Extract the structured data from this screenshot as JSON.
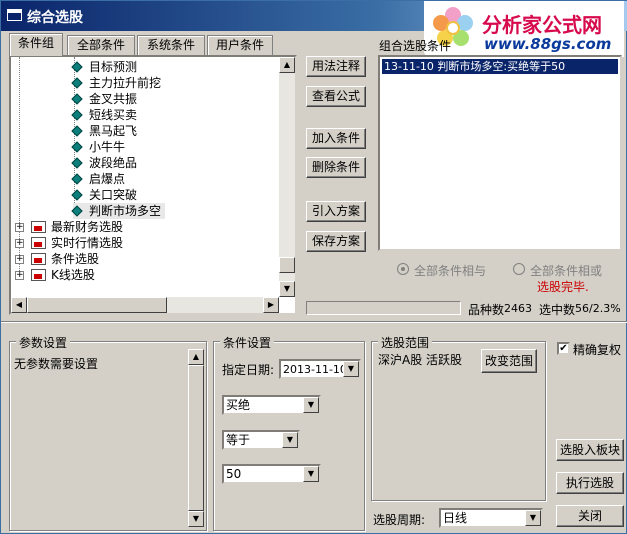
{
  "window": {
    "title": "综合选股"
  },
  "logo": {
    "main": "分析家公式网",
    "url": "www.88gs.com"
  },
  "tabs": [
    "条件组",
    "全部条件",
    "系统条件",
    "用户条件"
  ],
  "tree": {
    "leaves": [
      "目标预测",
      "主力拉升前挖",
      "金叉共振",
      "短线买卖",
      "黑马起飞",
      "小牛牛",
      "波段绝品",
      "启爆点",
      "关口突破",
      "判断市场多空"
    ],
    "groups": [
      "最新财务选股",
      "实时行情选股",
      "条件选股",
      "K线选股"
    ]
  },
  "middle_buttons": [
    "用法注释",
    "查看公式",
    "加入条件",
    "删除条件",
    "引入方案",
    "保存方案"
  ],
  "combo_list": {
    "label": "组合选股条件",
    "items": [
      "13-11-10 判断市场多空:买绝等于50"
    ]
  },
  "radios": {
    "all_and": "全部条件相与",
    "all_or": "全部条件相或"
  },
  "status": {
    "done": "选股完毕.",
    "count_label": "品种数",
    "count": "2463",
    "selected_label": "选中数",
    "selected": "56/2.3%"
  },
  "params": {
    "title": "参数设置",
    "text": "无参数需要设置"
  },
  "cond": {
    "title": "条件设置",
    "date_label": "指定日期:",
    "date": "2013-11-10",
    "select1": "买绝",
    "select2": "等于",
    "select3": "50"
  },
  "range": {
    "title": "选股范围",
    "text": "深沪A股 活跃股",
    "change_button": "改变范围"
  },
  "period": {
    "label": "选股周期:",
    "value": "日线"
  },
  "right": {
    "precise_label": "精确复权",
    "to_board": "选股入板块",
    "execute": "执行选股",
    "close": "关闭"
  },
  "colors": {
    "title_bar": "#0a246a",
    "selection": "#0a246a",
    "done_text": "#cc0000",
    "leaf_icon": "#0b7f7a"
  }
}
